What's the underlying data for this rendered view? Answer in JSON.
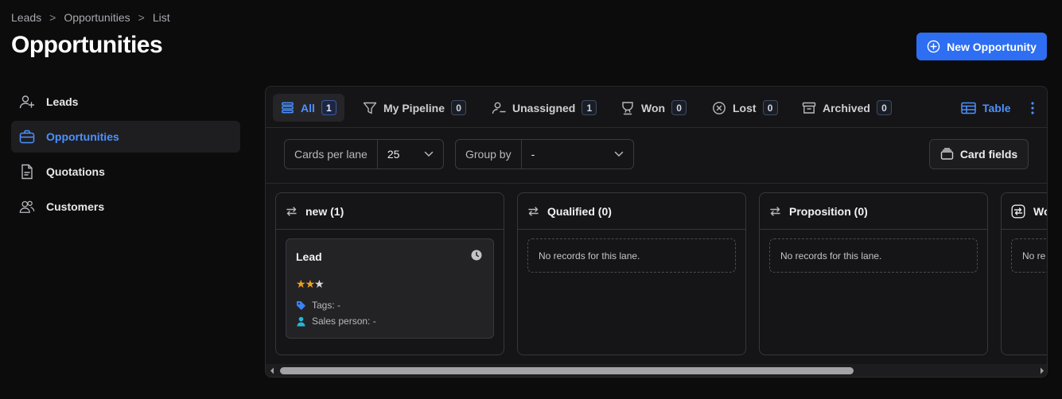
{
  "breadcrumb": {
    "items": [
      "Leads",
      "Opportunities",
      "List"
    ],
    "separator": ">"
  },
  "page": {
    "title": "Opportunities"
  },
  "actions": {
    "new_label": "New Opportunity"
  },
  "sidebar": {
    "items": [
      {
        "label": "Leads",
        "icon": "user-plus-icon",
        "active": false
      },
      {
        "label": "Opportunities",
        "icon": "briefcase-icon",
        "active": true
      },
      {
        "label": "Quotations",
        "icon": "document-icon",
        "active": false
      },
      {
        "label": "Customers",
        "icon": "users-icon",
        "active": false
      }
    ]
  },
  "tabs": [
    {
      "label": "All",
      "count": "1",
      "icon": "list-icon",
      "active": true
    },
    {
      "label": "My Pipeline",
      "count": "0",
      "icon": "filter-icon",
      "active": false
    },
    {
      "label": "Unassigned",
      "count": "1",
      "icon": "user-minus-icon",
      "active": false
    },
    {
      "label": "Won",
      "count": "0",
      "icon": "trophy-icon",
      "active": false
    },
    {
      "label": "Lost",
      "count": "0",
      "icon": "x-circle-icon",
      "active": false
    },
    {
      "label": "Archived",
      "count": "0",
      "icon": "archive-icon",
      "active": false
    }
  ],
  "view": {
    "table_label": "Table"
  },
  "toolbar": {
    "cards_per_lane_label": "Cards per lane",
    "cards_per_lane_value": "25",
    "group_by_label": "Group by",
    "group_by_value": "-",
    "card_fields_label": "Card fields"
  },
  "lanes": [
    {
      "title": "new (1)",
      "empty_text": ""
    },
    {
      "title": "Qualified (0)",
      "empty_text": "No records for this lane."
    },
    {
      "title": "Proposition (0)",
      "empty_text": "No records for this lane."
    },
    {
      "title": "Wo",
      "empty_text": "No re"
    }
  ],
  "card": {
    "title": "Lead",
    "rating": 2,
    "rating_max": 3,
    "tags_text": "Tags: -",
    "sales_person_text": "Sales person: -"
  },
  "colors": {
    "accent": "#2d6ef2",
    "link": "#4c91ff",
    "star": "#f0a020"
  }
}
